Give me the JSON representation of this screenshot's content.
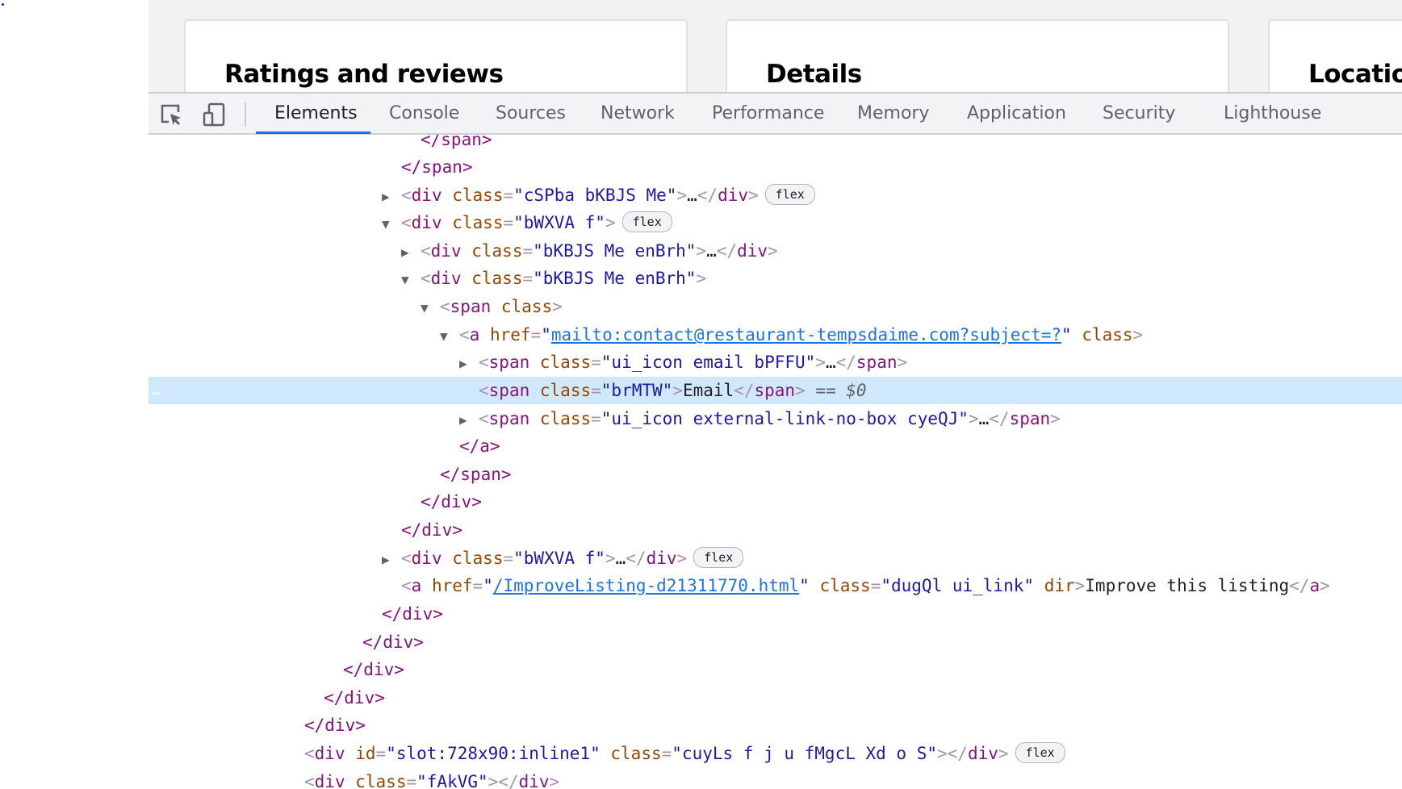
{
  "page": {
    "cards": [
      {
        "title": "Ratings and reviews"
      },
      {
        "title": "Details"
      },
      {
        "title": "Locatio"
      }
    ]
  },
  "devtools": {
    "toolbar": {
      "inspect_icon": "inspect-element-icon",
      "device_icon": "device-toolbar-icon",
      "tabs": [
        {
          "label": "Elements",
          "active": true
        },
        {
          "label": "Console"
        },
        {
          "label": "Sources"
        },
        {
          "label": "Network"
        },
        {
          "label": "Performance"
        },
        {
          "label": "Memory"
        },
        {
          "label": "Application"
        },
        {
          "label": "Security"
        },
        {
          "label": "Lighthouse"
        }
      ]
    },
    "accent_color": "#1a73e8",
    "selected_row_color": "#cfe8fc",
    "dom": {
      "l0": {
        "close": "</span>"
      },
      "l1": {
        "close": "</span>"
      },
      "l2": {
        "tag": "div",
        "attr": "class",
        "val": "cSPba bKBJS Me",
        "ellipsis": "…",
        "badge": "flex"
      },
      "l3": {
        "tag": "div",
        "attr": "class",
        "val": "bWXVA f",
        "badge": "flex"
      },
      "l4": {
        "tag": "div",
        "attr": "class",
        "val": "bKBJS Me enBrh",
        "ellipsis": "…"
      },
      "l5": {
        "tag": "div",
        "attr": "class",
        "val": "bKBJS Me enBrh"
      },
      "l6": {
        "tag": "span",
        "attr": "class"
      },
      "l7": {
        "tag": "a",
        "attr": "href",
        "val": "mailto:contact@restaurant-tempsdaime.com?subject=?",
        "attr2": "class"
      },
      "l8": {
        "tag": "span",
        "attr": "class",
        "val": "ui_icon email bPFFU",
        "ellipsis": "…"
      },
      "l9": {
        "tag": "span",
        "attr": "class",
        "val": "brMTW",
        "text": "Email",
        "ref": "== $0",
        "dots": "…"
      },
      "l10": {
        "tag": "span",
        "attr": "class",
        "val": "ui_icon external-link-no-box cyeQJ",
        "ellipsis": "…"
      },
      "l11": {
        "close": "</a>"
      },
      "l12": {
        "close": "</span>"
      },
      "l13": {
        "close": "</div>"
      },
      "l14": {
        "close": "</div>"
      },
      "l15": {
        "tag": "div",
        "attr": "class",
        "val": "bWXVA f",
        "ellipsis": "…",
        "badge": "flex"
      },
      "l16": {
        "tag": "a",
        "attr": "href",
        "val": "/ImproveListing-d21311770.html",
        "attr2": "class",
        "val2": "dugQl ui_link",
        "attr3": "dir",
        "text": "Improve this listing"
      },
      "l17": {
        "close": "</div>"
      },
      "l18": {
        "close": "</div>"
      },
      "l19": {
        "close": "</div>"
      },
      "l20": {
        "close": "</div>"
      },
      "l21": {
        "close": "</div>"
      },
      "l22": {
        "tag": "div",
        "attr": "id",
        "val": "slot:728x90:inline1",
        "attr2": "class",
        "val2": "cuyLs f j u fMgcL Xd o S",
        "badge": "flex"
      },
      "l23": {
        "tag": "div",
        "attr": "class",
        "val": "fAkVG"
      }
    }
  }
}
